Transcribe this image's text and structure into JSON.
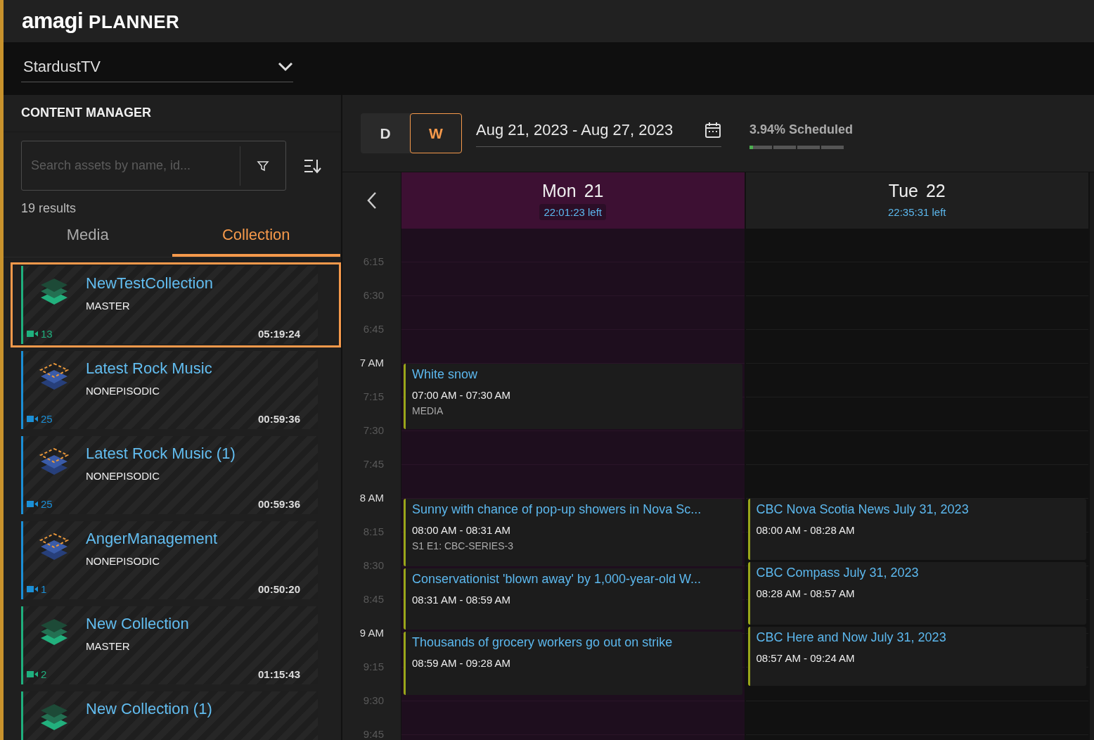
{
  "logo": {
    "brand": "amagi",
    "product": "PLANNER"
  },
  "channel_select": {
    "value": "StardustTV"
  },
  "content_manager": {
    "title": "CONTENT MANAGER",
    "search": {
      "placeholder": "Search assets by name, id..."
    },
    "results": "19 results",
    "tabs": [
      {
        "label": "Media",
        "selected": false
      },
      {
        "label": "Collection",
        "selected": true
      }
    ],
    "cards": [
      {
        "title": "NewTestCollection",
        "type": "MASTER",
        "count": "13",
        "duration": "05:19:24",
        "kind": "master",
        "color": "#1fb07e",
        "selected": true
      },
      {
        "title": "Latest Rock Music",
        "type": "NONEPISODIC",
        "count": "25",
        "duration": "00:59:36",
        "kind": "nonepisodic",
        "color": "#1b8fd6",
        "selected": false
      },
      {
        "title": "Latest Rock Music (1)",
        "type": "NONEPISODIC",
        "count": "25",
        "duration": "00:59:36",
        "kind": "nonepisodic",
        "color": "#1b8fd6",
        "selected": false
      },
      {
        "title": "AngerManagement",
        "type": "NONEPISODIC",
        "count": "1",
        "duration": "00:50:20",
        "kind": "nonepisodic",
        "color": "#1b8fd6",
        "selected": false
      },
      {
        "title": "New Collection",
        "type": "MASTER",
        "count": "2",
        "duration": "01:15:43",
        "kind": "master",
        "color": "#1fb07e",
        "selected": false
      },
      {
        "title": "New Collection (1)",
        "kind": "master",
        "color": "#1fb07e",
        "selected": false
      }
    ]
  },
  "toolbar": {
    "view_modes": [
      {
        "label": "D",
        "selected": false
      },
      {
        "label": "W",
        "selected": true
      }
    ],
    "date_range": "Aug 21, 2023 - Aug 27, 2023",
    "scheduled": {
      "label": "3.94% Scheduled",
      "level": 0.0394
    }
  },
  "calendar": {
    "time_labels": [
      {
        "label": "6:15",
        "kind": "quarter"
      },
      {
        "label": "6:30",
        "kind": "quarter"
      },
      {
        "label": "6:45",
        "kind": "quarter"
      },
      {
        "label": "7 AM",
        "kind": "hour"
      },
      {
        "label": "7:15",
        "kind": "quarter"
      },
      {
        "label": "7:30",
        "kind": "quarter"
      },
      {
        "label": "7:45",
        "kind": "quarter"
      },
      {
        "label": "8 AM",
        "kind": "hour"
      },
      {
        "label": "8:15",
        "kind": "quarter"
      },
      {
        "label": "8:30",
        "kind": "quarter"
      },
      {
        "label": "8:45",
        "kind": "quarter"
      },
      {
        "label": "9 AM",
        "kind": "hour"
      },
      {
        "label": "9:15",
        "kind": "quarter"
      },
      {
        "label": "9:30",
        "kind": "quarter"
      },
      {
        "label": "9:45",
        "kind": "quarter"
      }
    ],
    "days": [
      {
        "weekday": "Mon",
        "day": "21",
        "remaining": "22:01:23 left",
        "selected": true,
        "events": [
          {
            "title": "White snow",
            "time": "07:00 AM - 07:30 AM",
            "subtitle": "MEDIA"
          },
          {
            "title": "Sunny with chance of pop-up showers in Nova Sc...",
            "time": "08:00 AM - 08:31 AM",
            "subtitle": "S1 E1: CBC-SERIES-3"
          },
          {
            "title": "Conservationist 'blown away' by 1,000-year-old W...",
            "time": "08:31 AM - 08:59 AM"
          },
          {
            "title": "Thousands of grocery workers go out on strike",
            "time": "08:59 AM - 09:28 AM"
          }
        ]
      },
      {
        "weekday": "Tue",
        "day": "22",
        "remaining": "22:35:31 left",
        "selected": false,
        "events": [
          {
            "title": "CBC Nova Scotia News July 31, 2023",
            "time": "08:00 AM - 08:28 AM"
          },
          {
            "title": "CBC Compass July 31, 2023",
            "time": "08:28 AM - 08:57 AM"
          },
          {
            "title": "CBC Here and Now July 31, 2023",
            "time": "08:57 AM - 09:24 AM"
          }
        ]
      }
    ]
  }
}
